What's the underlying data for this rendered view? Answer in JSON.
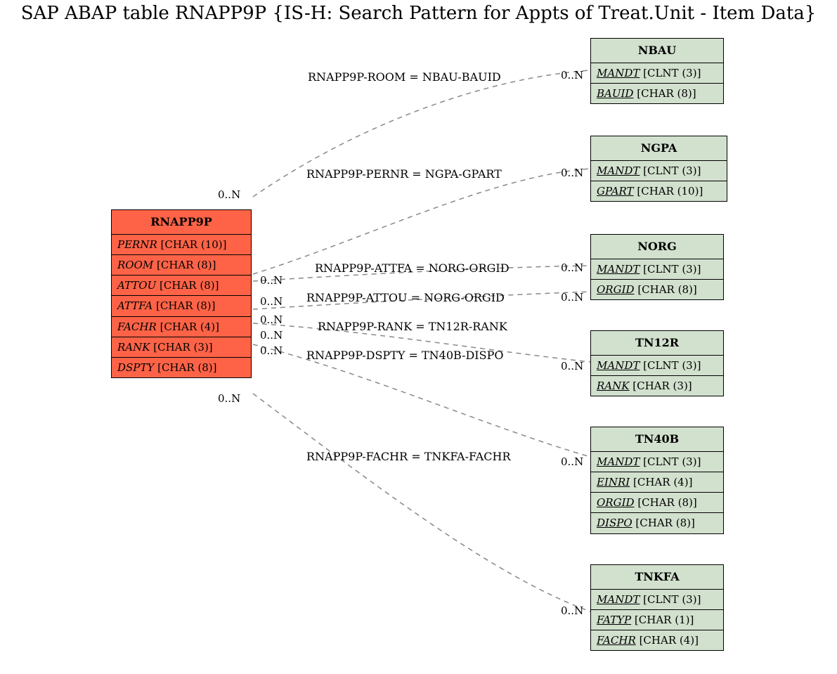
{
  "title": "SAP ABAP table RNAPP9P {IS-H: Search Pattern for Appts of Treat.Unit - Item Data}",
  "main": {
    "name": "RNAPP9P",
    "color": "#ff6347",
    "fields": [
      {
        "name": "PERNR",
        "type": "[CHAR (10)]",
        "key": false
      },
      {
        "name": "ROOM",
        "type": "[CHAR (8)]",
        "key": false
      },
      {
        "name": "ATTOU",
        "type": "[CHAR (8)]",
        "key": false
      },
      {
        "name": "ATTFA",
        "type": "[CHAR (8)]",
        "key": false
      },
      {
        "name": "FACHR",
        "type": "[CHAR (4)]",
        "key": false
      },
      {
        "name": "RANK",
        "type": "[CHAR (3)]",
        "key": false
      },
      {
        "name": "DSPTY",
        "type": "[CHAR (8)]",
        "key": false
      }
    ]
  },
  "related": [
    {
      "name": "NBAU",
      "fields": [
        {
          "name": "MANDT",
          "type": "[CLNT (3)]",
          "key": true
        },
        {
          "name": "BAUID",
          "type": "[CHAR (8)]",
          "key": true
        }
      ]
    },
    {
      "name": "NGPA",
      "fields": [
        {
          "name": "MANDT",
          "type": "[CLNT (3)]",
          "key": true
        },
        {
          "name": "GPART",
          "type": "[CHAR (10)]",
          "key": true
        }
      ]
    },
    {
      "name": "NORG",
      "fields": [
        {
          "name": "MANDT",
          "type": "[CLNT (3)]",
          "key": true
        },
        {
          "name": "ORGID",
          "type": "[CHAR (8)]",
          "key": true
        }
      ]
    },
    {
      "name": "TN12R",
      "fields": [
        {
          "name": "MANDT",
          "type": "[CLNT (3)]",
          "key": true
        },
        {
          "name": "RANK",
          "type": "[CHAR (3)]",
          "key": true
        }
      ]
    },
    {
      "name": "TN40B",
      "fields": [
        {
          "name": "MANDT",
          "type": "[CLNT (3)]",
          "key": true
        },
        {
          "name": "EINRI",
          "type": "[CHAR (4)]",
          "key": true
        },
        {
          "name": "ORGID",
          "type": "[CHAR (8)]",
          "key": true
        },
        {
          "name": "DISPO",
          "type": "[CHAR (8)]",
          "key": true
        }
      ]
    },
    {
      "name": "TNKFA",
      "fields": [
        {
          "name": "MANDT",
          "type": "[CLNT (3)]",
          "key": true
        },
        {
          "name": "FATYP",
          "type": "[CHAR (1)]",
          "key": true
        },
        {
          "name": "FACHR",
          "type": "[CHAR (4)]",
          "key": true
        }
      ]
    }
  ],
  "links": [
    {
      "label": "RNAPP9P-ROOM = NBAU-BAUID",
      "left_card": "0..N",
      "right_card": "0..N"
    },
    {
      "label": "RNAPP9P-PERNR = NGPA-GPART",
      "left_card": "0..N",
      "right_card": "0..N"
    },
    {
      "label": "RNAPP9P-ATTFA = NORG-ORGID",
      "left_card": "0..N",
      "right_card": "0..N"
    },
    {
      "label": "RNAPP9P-ATTOU = NORG-ORGID",
      "left_card": "0..N",
      "right_card": "0..N"
    },
    {
      "label": "RNAPP9P-RANK = TN12R-RANK",
      "left_card": "0..N",
      "right_card": "0..N"
    },
    {
      "label": "RNAPP9P-DSPTY = TN40B-DISPO",
      "left_card": "0..N",
      "right_card": "0..N"
    },
    {
      "label": "RNAPP9P-FACHR = TNKFA-FACHR",
      "left_card": "0..N",
      "right_card": "0..N"
    }
  ]
}
